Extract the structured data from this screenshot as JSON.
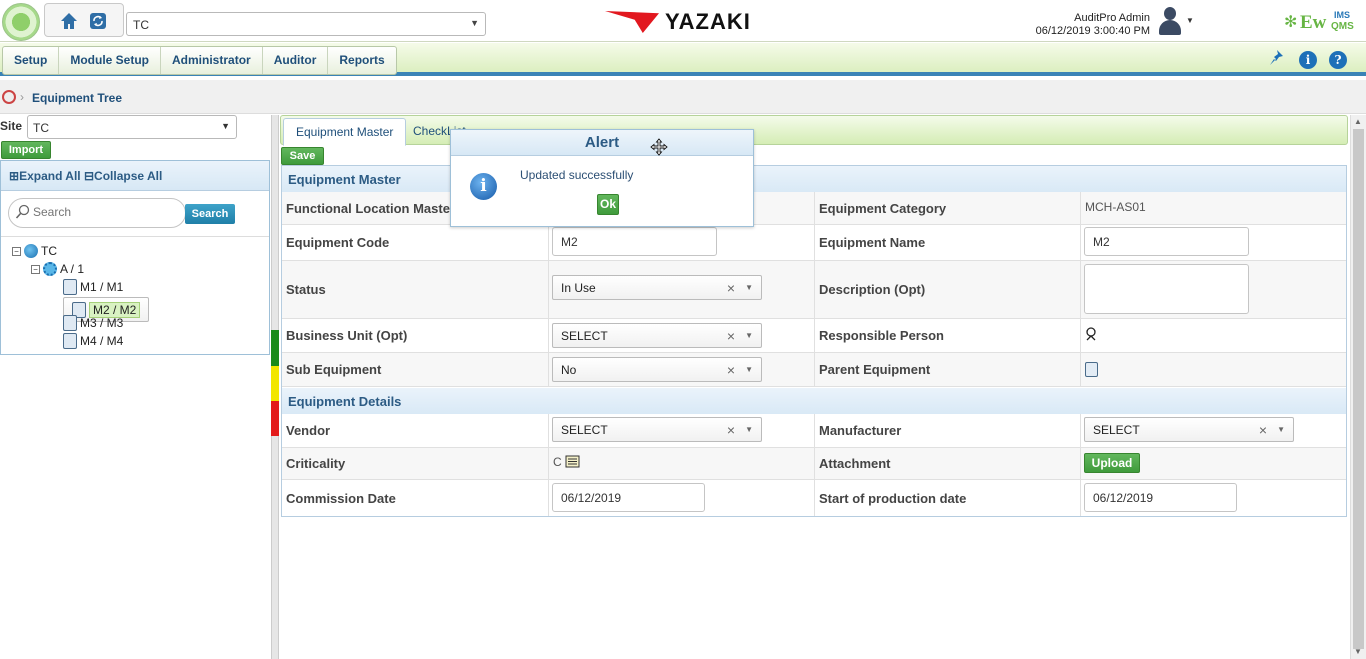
{
  "header": {
    "site_select": "TC",
    "brand": "YAZAKI",
    "user_name": "AuditPro Admin",
    "datetime": "06/12/2019 3:00:40 PM",
    "product_logo": "EwQMS IMS"
  },
  "menu": {
    "items": [
      "Setup",
      "Module Setup",
      "Administrator",
      "Auditor",
      "Reports"
    ]
  },
  "breadcrumb": {
    "label": "Equipment Tree"
  },
  "left": {
    "site_label": "Site",
    "site_value": "TC",
    "import_label": "Import",
    "expand_all": "Expand All",
    "collapse_all": "Collapse All",
    "search_placeholder": "Search",
    "search_button": "Search",
    "tree": {
      "root": "TC",
      "child": "A / 1",
      "leaves": [
        "M1 / M1",
        "M2 / M2",
        "M3 / M3",
        "M4 / M4"
      ],
      "selected": "M2 / M2"
    },
    "status_colors": [
      "#1a8a1a",
      "#f2e600",
      "#e31b1b"
    ]
  },
  "tabs": [
    "Equipment Master",
    "CheckList"
  ],
  "save_label": "Save",
  "form": {
    "section_master": "Equipment Master",
    "functional_location_label": "Functional Location Master",
    "equipment_category_label": "Equipment Category",
    "equipment_category_value": "MCH-AS01",
    "equipment_code_label": "Equipment Code",
    "equipment_code_value": "M2",
    "equipment_name_label": "Equipment Name",
    "equipment_name_value": "M2",
    "status_label": "Status",
    "status_value": "In Use",
    "description_label": "Description (Opt)",
    "business_unit_label": "Business Unit (Opt)",
    "business_unit_value": "SELECT",
    "responsible_person_label": "Responsible Person",
    "sub_equipment_label": "Sub Equipment",
    "sub_equipment_value": "No",
    "parent_equipment_label": "Parent Equipment",
    "section_details": "Equipment Details",
    "vendor_label": "Vendor",
    "vendor_value": "SELECT",
    "manufacturer_label": "Manufacturer",
    "manufacturer_value": "SELECT",
    "criticality_label": "Criticality",
    "criticality_value": "C",
    "attachment_label": "Attachment",
    "upload_label": "Upload",
    "commission_date_label": "Commission Date",
    "commission_date_value": "06/12/2019",
    "production_date_label": "Start of production date",
    "production_date_value": "06/12/2019"
  },
  "alert": {
    "title": "Alert",
    "message": "Updated successfully",
    "ok_label": "Ok"
  },
  "colors": {
    "accent_blue": "#1f4f7a",
    "accent_green": "#3f9b3c",
    "menu_bar_bottom": "#3a83b6"
  }
}
